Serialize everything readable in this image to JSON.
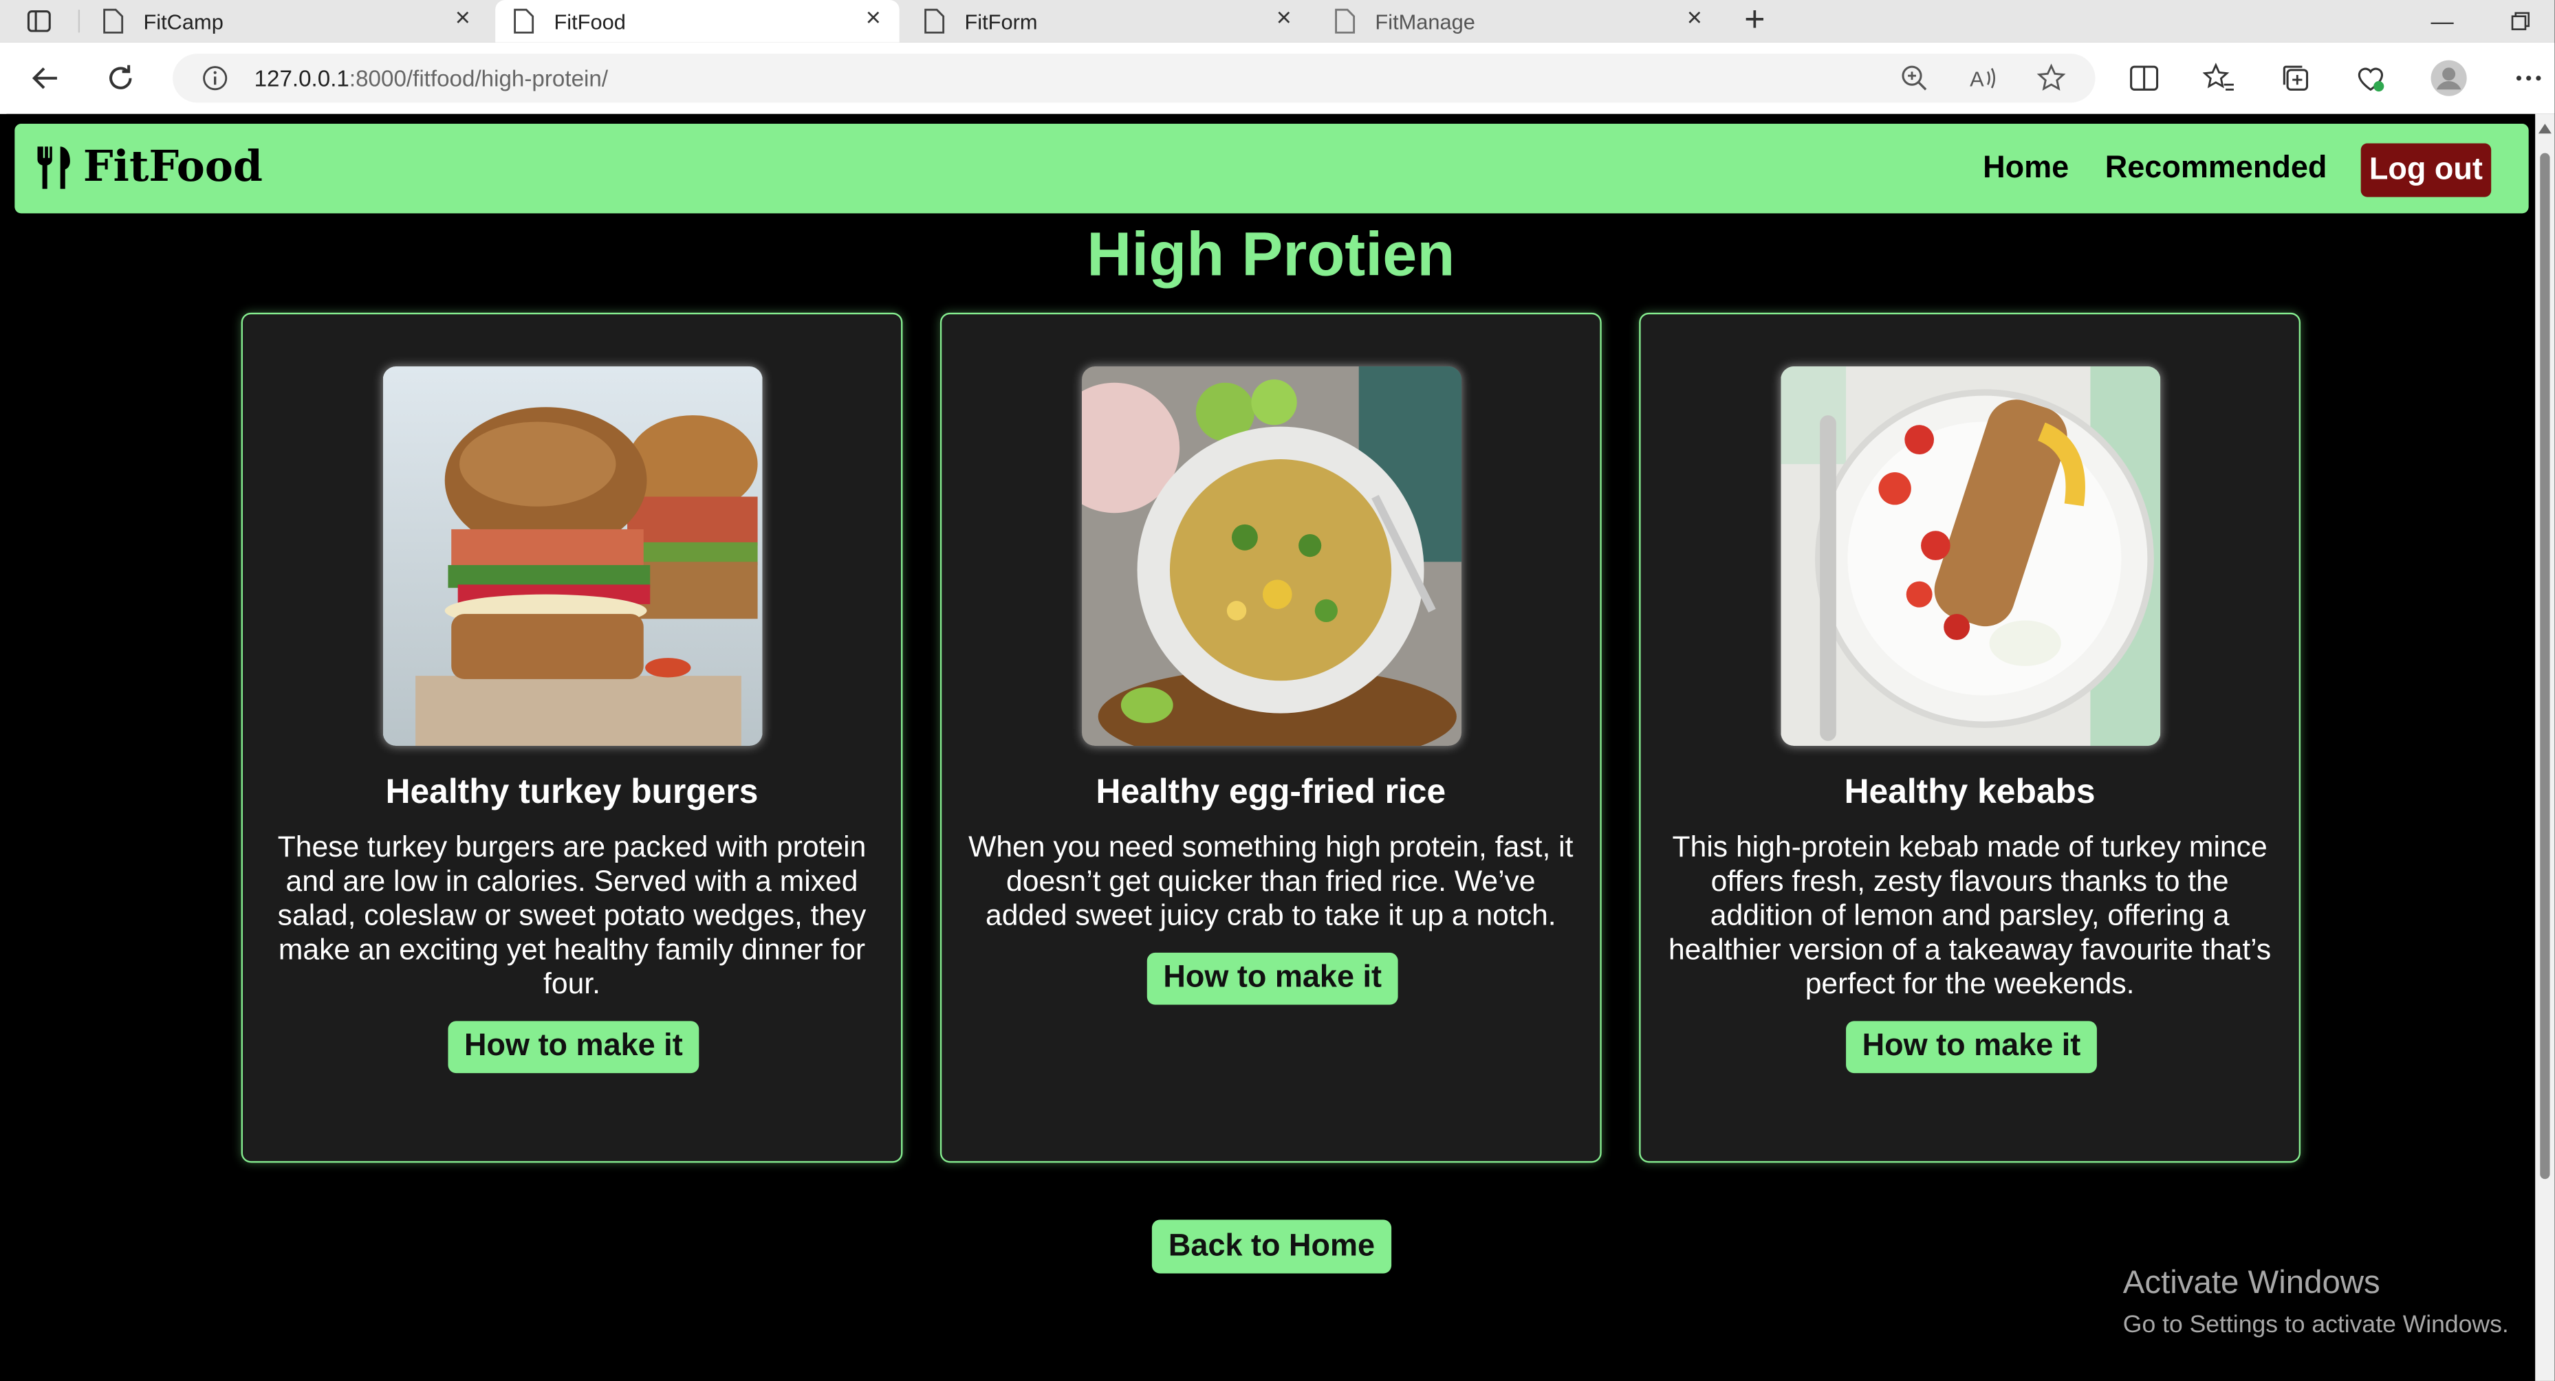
{
  "browser": {
    "tabs": [
      {
        "label": "FitCamp",
        "active": false
      },
      {
        "label": "FitFood",
        "active": true
      },
      {
        "label": "FitForm",
        "active": false
      },
      {
        "label": "FitManage",
        "active": false
      }
    ],
    "url_host": "127.0.0.1",
    "url_rest": ":8000/fitfood/high-protein/"
  },
  "navbar": {
    "brand": "FitFood",
    "links": [
      "Home",
      "Recommended"
    ],
    "logout_label": "Log out",
    "accent_color": "#86ee90",
    "logout_color": "#7a0f0f"
  },
  "page": {
    "title": "High Protien",
    "back_label": "Back to Home"
  },
  "cards": [
    {
      "title": "Healthy turkey burgers",
      "description": "These turkey burgers are packed with protein and are low in calories. Served with a mixed salad, coleslaw or sweet potato wedges, they make an exciting yet healthy family dinner for four.",
      "button_label": "How to make it",
      "image_icon": "turkey-burger-photo"
    },
    {
      "title": "Healthy egg-fried rice",
      "description": "When you need something high protein, fast, it doesn’t get quicker than fried rice. We’ve added sweet juicy crab to take it up a notch.",
      "button_label": "How to make it",
      "image_icon": "egg-fried-rice-photo"
    },
    {
      "title": "Healthy kebabs",
      "description": "This high-protein kebab made of turkey mince offers fresh, zesty flavours thanks to the addition of lemon and parsley, offering a healthier version of a takeaway favourite that’s perfect for the weekends.",
      "button_label": "How to make it",
      "image_icon": "kebab-plate-photo"
    }
  ],
  "watermark": {
    "line1": "Activate Windows",
    "line2": "Go to Settings to activate Windows."
  }
}
